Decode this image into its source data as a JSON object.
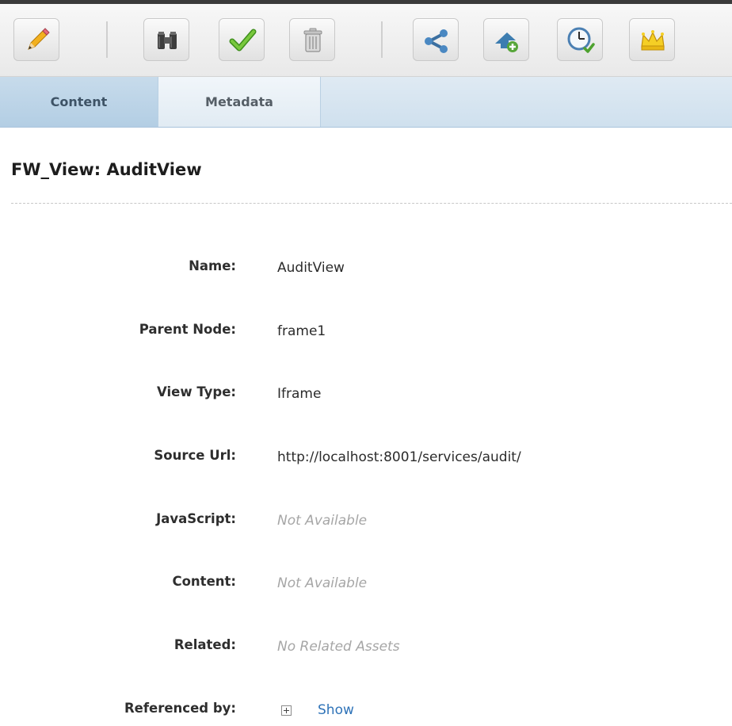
{
  "toolbar": {
    "buttons": [
      {
        "icon": "pencil-icon"
      },
      {
        "icon": "binoculars-icon"
      },
      {
        "icon": "checkmark-icon"
      },
      {
        "icon": "trash-icon"
      },
      {
        "icon": "share-icon"
      },
      {
        "icon": "add-bookmark-icon"
      },
      {
        "icon": "history-icon"
      },
      {
        "icon": "crown-icon"
      }
    ]
  },
  "tabs": [
    {
      "label": "Content",
      "active": true
    },
    {
      "label": "Metadata",
      "active": false
    }
  ],
  "page": {
    "title": "FW_View: AuditView"
  },
  "fields": {
    "name": {
      "label": "Name:",
      "value": "AuditView"
    },
    "parent_node": {
      "label": "Parent Node:",
      "value": "frame1"
    },
    "view_type": {
      "label": "View Type:",
      "value": "Iframe"
    },
    "source_url": {
      "label": "Source Url:",
      "value": "http://localhost:8001/services/audit/"
    },
    "javascript": {
      "label": "JavaScript:",
      "value": "Not Available"
    },
    "content": {
      "label": "Content:",
      "value": "Not Available"
    },
    "related": {
      "label": "Related:",
      "value": "No Related Assets"
    },
    "referenced_by": {
      "label": "Referenced by:",
      "link": "Show"
    }
  },
  "colors": {
    "tab_active_bg": "#b3cee4",
    "link": "#2f73b8",
    "placeholder_text": "#a6a6a6"
  }
}
